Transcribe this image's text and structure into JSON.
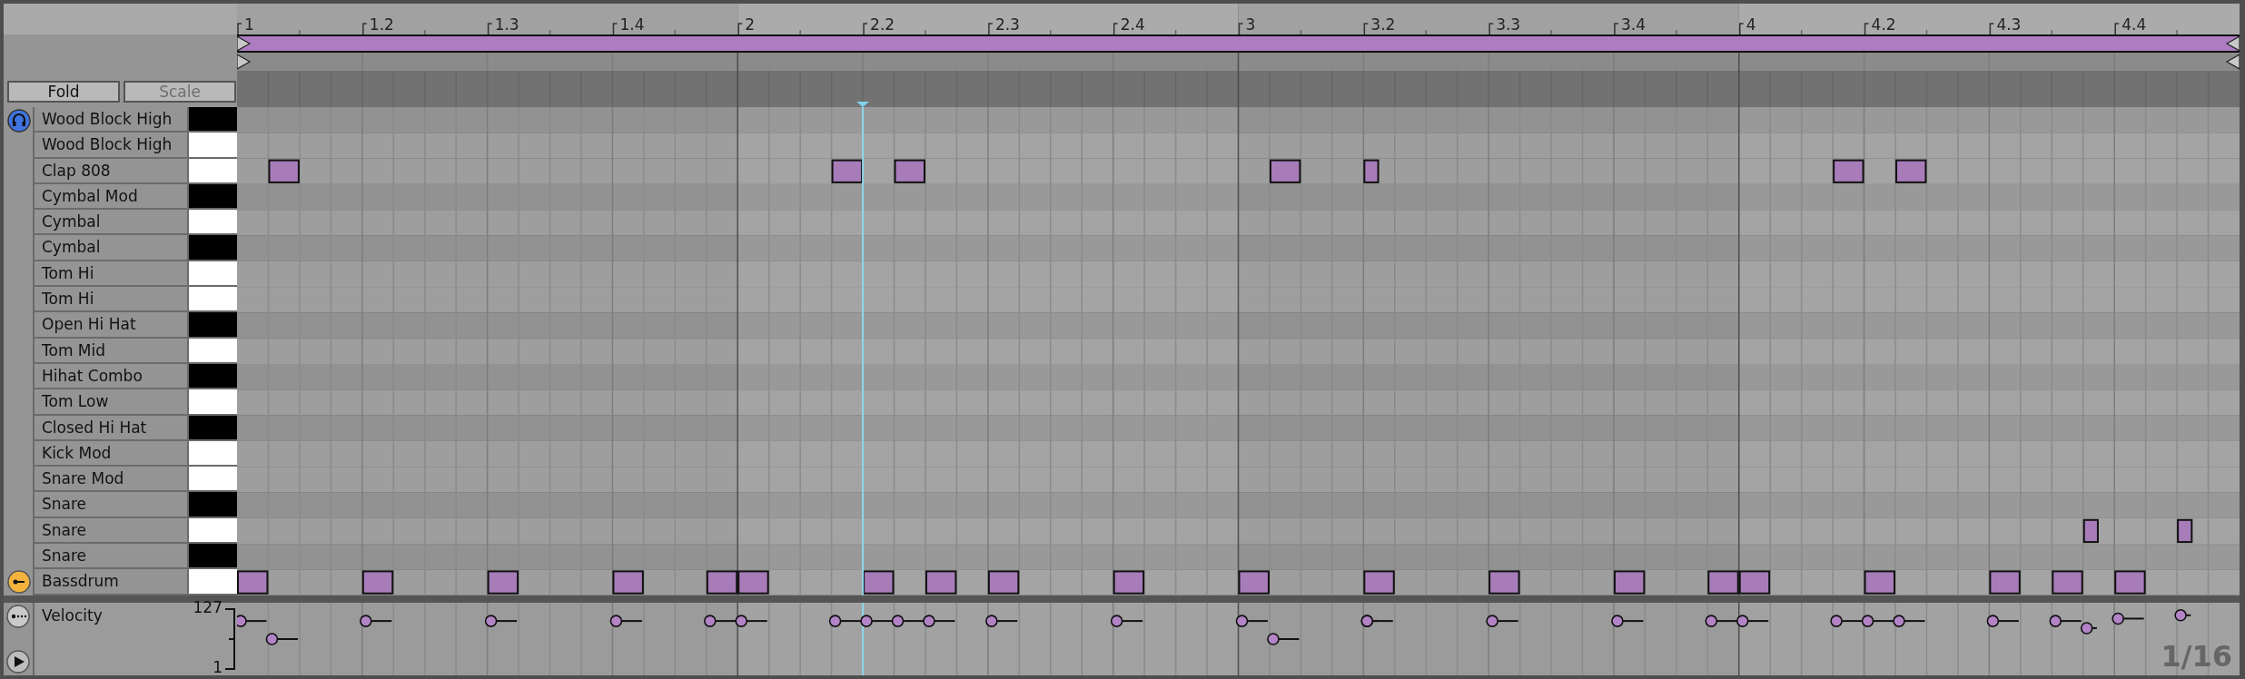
{
  "buttons": [
    {
      "label": "Fold",
      "disabled": false
    },
    {
      "label": "Scale",
      "disabled": true
    }
  ],
  "ruler": {
    "labels": [
      "1",
      "1.2",
      "1.3",
      "1.4",
      "2",
      "2.2",
      "2.3",
      "2.4",
      "3",
      "3.2",
      "3.3",
      "3.4",
      "4",
      "4.2",
      "4.3",
      "4.4"
    ]
  },
  "keys": [
    {
      "name": "Wood Block High",
      "black": true
    },
    {
      "name": "Wood Block High",
      "black": false
    },
    {
      "name": "Clap 808",
      "black": false
    },
    {
      "name": "Cymbal Mod",
      "black": true
    },
    {
      "name": "Cymbal",
      "black": false
    },
    {
      "name": "Cymbal",
      "black": true
    },
    {
      "name": "Tom Hi",
      "black": false
    },
    {
      "name": "Tom Hi",
      "black": false
    },
    {
      "name": "Open Hi Hat",
      "black": true
    },
    {
      "name": "Tom Mid",
      "black": false
    },
    {
      "name": "Hihat Combo",
      "black": true
    },
    {
      "name": "Tom Low",
      "black": false
    },
    {
      "name": "Closed Hi Hat",
      "black": true
    },
    {
      "name": "Kick Mod",
      "black": false
    },
    {
      "name": "Snare Mod",
      "black": false
    },
    {
      "name": "Snare",
      "black": true
    },
    {
      "name": "Snare",
      "black": false
    },
    {
      "name": "Snare",
      "black": true
    },
    {
      "name": "Bassdrum",
      "black": false
    }
  ],
  "velocity": {
    "label": "Velocity",
    "max_label": "127",
    "min_label": "1"
  },
  "grid_label": "1/16"
}
